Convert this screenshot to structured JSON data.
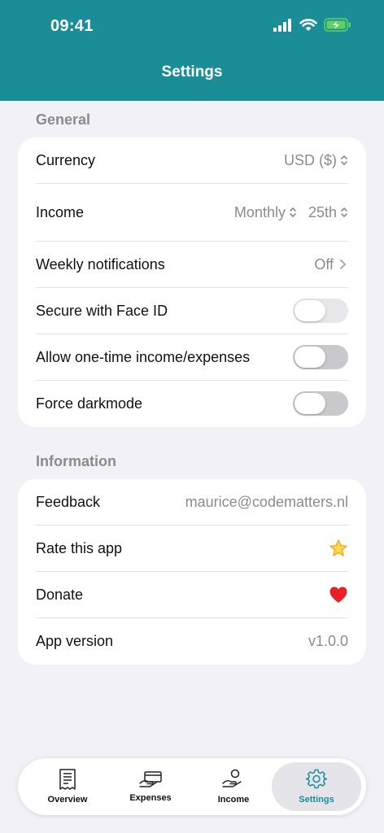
{
  "status_bar": {
    "time": "09:41"
  },
  "header": {
    "title": "Settings"
  },
  "general": {
    "label": "General",
    "currency": {
      "label": "Currency",
      "value": "USD ($)"
    },
    "income": {
      "label": "Income",
      "period": "Monthly",
      "day": "25th"
    },
    "notifications": {
      "label": "Weekly notifications",
      "value": "Off"
    },
    "face_id": {
      "label": "Secure with Face ID",
      "on": false
    },
    "one_time": {
      "label": "Allow one-time income/expenses",
      "on": false
    },
    "darkmode": {
      "label": "Force darkmode",
      "on": false
    }
  },
  "information": {
    "label": "Information",
    "feedback": {
      "label": "Feedback",
      "value": "maurice@codematters.nl"
    },
    "rate": {
      "label": "Rate this app",
      "icon": "star-icon"
    },
    "donate": {
      "label": "Donate",
      "icon": "heart-icon"
    },
    "version": {
      "label": "App version",
      "value": "v1.0.0"
    }
  },
  "tabs": [
    {
      "label": "Overview",
      "icon": "receipt-icon"
    },
    {
      "label": "Expenses",
      "icon": "card-icon"
    },
    {
      "label": "Income",
      "icon": "hand-coin-icon"
    },
    {
      "label": "Settings",
      "icon": "gear-icon",
      "active": true
    }
  ],
  "colors": {
    "accent": "#1b8d97",
    "background": "#f2f1f6"
  }
}
